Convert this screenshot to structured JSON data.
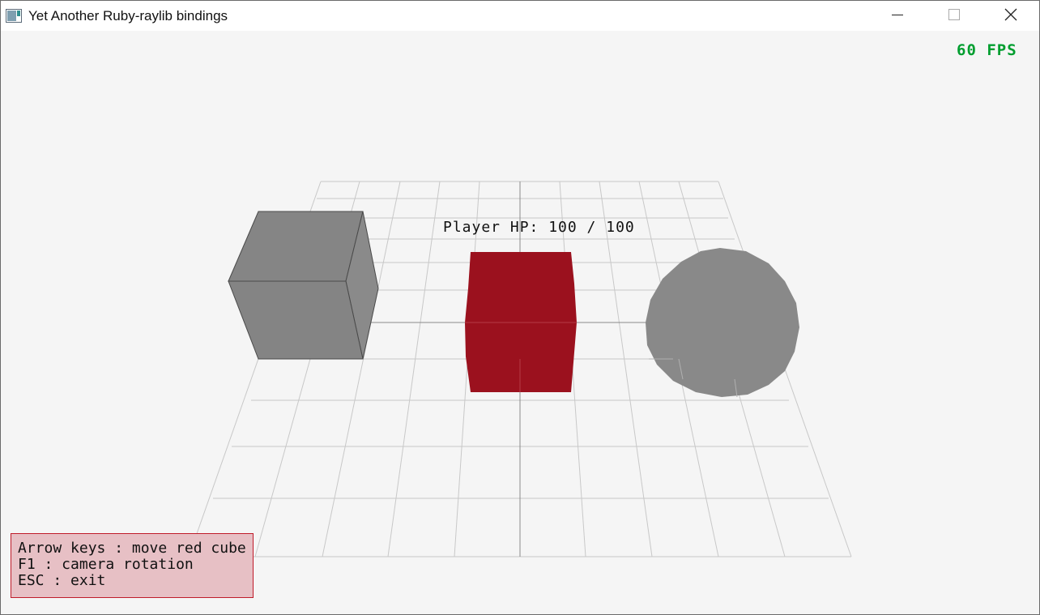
{
  "window": {
    "title": "Yet Another Ruby-raylib bindings",
    "icons": {
      "app": "window-app-icon",
      "minimize": "minimize-icon",
      "maximize": "maximize-icon",
      "close": "close-icon"
    }
  },
  "hud": {
    "fps": "60 FPS",
    "player_hp": "Player HP: 100 / 100",
    "help": [
      "Arrow keys : move red cube",
      "F1 : camera rotation",
      "ESC : exit"
    ]
  },
  "scene": {
    "objects": [
      {
        "name": "gray cube",
        "color": "#858585"
      },
      {
        "name": "player red cube",
        "color": "#9b111e"
      },
      {
        "name": "gray sphere",
        "color": "#898989"
      }
    ],
    "grid_color": "#c8c8c8",
    "axis_color": "#8a8a8a"
  },
  "colors": {
    "background": "#f5f5f5",
    "fps": "#009e2f",
    "help_bg": "#e7c0c5",
    "help_border": "#c01c2a"
  }
}
